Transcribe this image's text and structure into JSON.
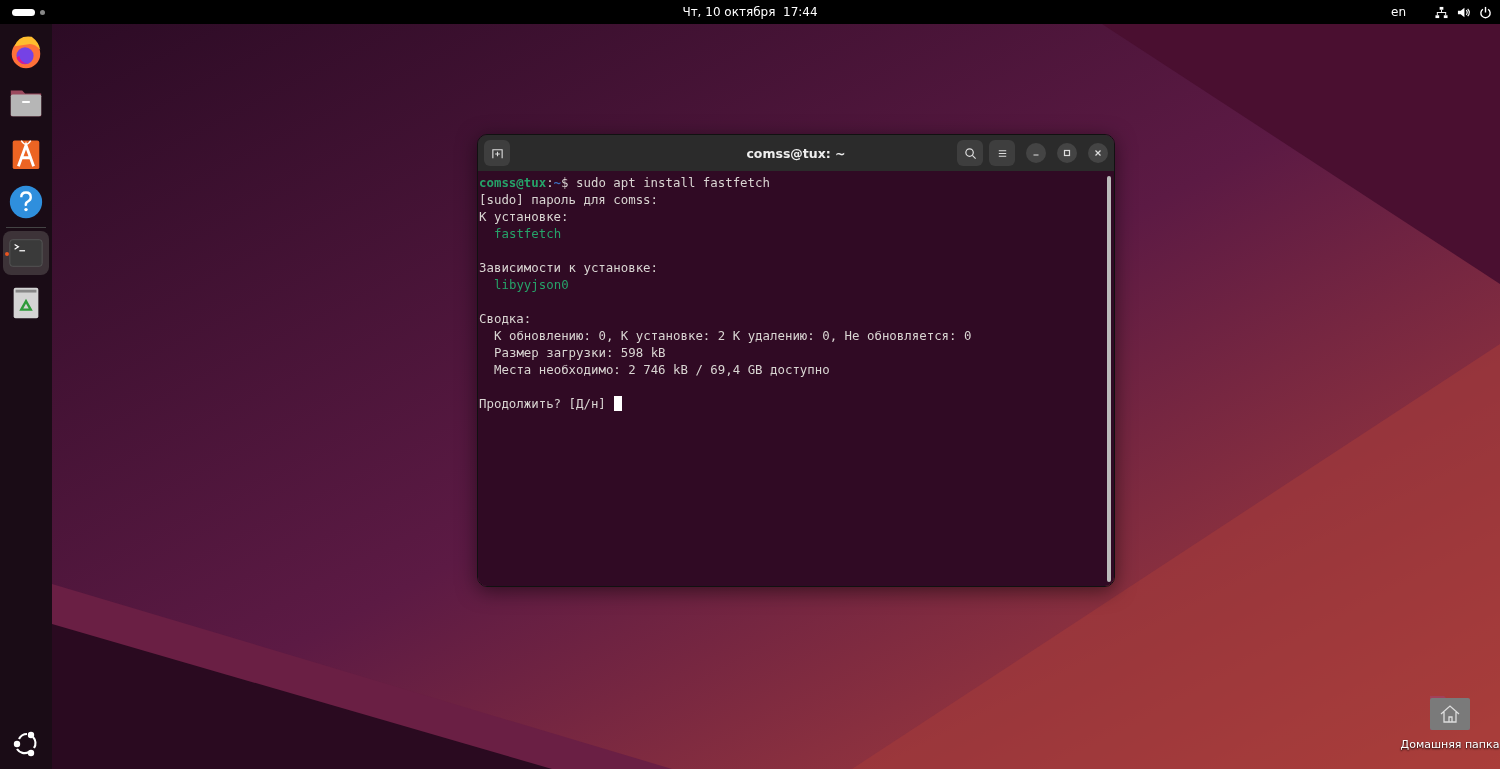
{
  "top_bar": {
    "clock": "Чт, 10 октября  17:44",
    "keyboard_layout": "en"
  },
  "dock": {
    "items": [
      {
        "kind": "browser",
        "active": false
      },
      {
        "kind": "files",
        "active": false
      },
      {
        "kind": "store",
        "active": false
      },
      {
        "kind": "help",
        "active": false
      },
      {
        "kind": "terminal",
        "active": true
      },
      {
        "kind": "trash",
        "active": false
      }
    ]
  },
  "terminal": {
    "title": "comss@tux: ~",
    "cursor": true,
    "blocks": [
      {
        "lines": [
          {
            "indented": false,
            "segments": [
              {
                "kind": "user",
                "text": "comss@tux"
              },
              {
                "kind": "plain",
                "text": ":"
              },
              {
                "kind": "path",
                "text": "~"
              },
              {
                "kind": "plain",
                "text": "$ sudo apt install fastfetch"
              }
            ]
          },
          {
            "indented": false,
            "segments": [
              {
                "kind": "plain",
                "text": "[sudo] пароль для comss:"
              }
            ]
          },
          {
            "indented": false,
            "segments": [
              {
                "kind": "plain",
                "text": "К установке:"
              }
            ]
          },
          {
            "indented": true,
            "segments": [
              {
                "kind": "package",
                "text": "fastfetch"
              }
            ]
          }
        ]
      },
      {
        "lines": [
          {
            "indented": false,
            "segments": [
              {
                "kind": "plain",
                "text": "Зависимости к установке:"
              }
            ]
          },
          {
            "indented": true,
            "segments": [
              {
                "kind": "package",
                "text": "libyyjson0"
              }
            ]
          }
        ]
      },
      {
        "lines": [
          {
            "indented": false,
            "segments": [
              {
                "kind": "plain",
                "text": "Сводка:"
              }
            ]
          },
          {
            "indented": true,
            "segments": [
              {
                "kind": "plain",
                "text": "К обновлению: 0, К установке: 2 К удалению: 0, Не обновляется: 0"
              }
            ]
          },
          {
            "indented": true,
            "segments": [
              {
                "kind": "plain",
                "text": "Размер загрузки: 598 kB"
              }
            ]
          },
          {
            "indented": true,
            "segments": [
              {
                "kind": "plain",
                "text": "Места необходимо: 2 746 kB / 69,4 GB доступно"
              }
            ]
          }
        ]
      },
      {
        "lines": [
          {
            "indented": false,
            "segments": [
              {
                "kind": "plain",
                "text": "Продолжить? [Д/н]"
              }
            ]
          }
        ]
      }
    ]
  },
  "desktop_icons": [
    {
      "kind": "home",
      "label": "Домашняя папка"
    }
  ]
}
